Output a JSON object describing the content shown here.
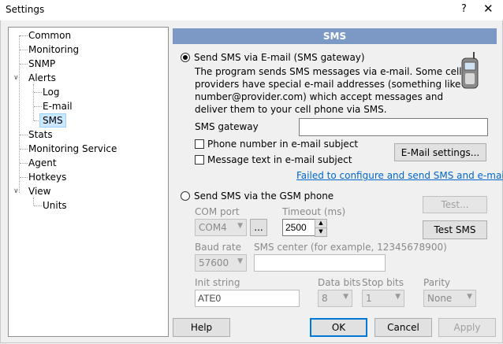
{
  "window": {
    "title": "Settings",
    "help_glyph": "?",
    "close_glyph": "✕"
  },
  "tree": {
    "items": [
      {
        "label": "Common"
      },
      {
        "label": "Monitoring"
      },
      {
        "label": "SNMP"
      },
      {
        "label": "Alerts"
      },
      {
        "label": "Log"
      },
      {
        "label": "E-mail"
      },
      {
        "label": "SMS"
      },
      {
        "label": "Stats"
      },
      {
        "label": "Monitoring Service"
      },
      {
        "label": "Agent"
      },
      {
        "label": "Hotkeys"
      },
      {
        "label": "View"
      },
      {
        "label": "Units"
      }
    ],
    "selected": "SMS"
  },
  "panel": {
    "header": "SMS",
    "email_option": {
      "label": "Send SMS via E-mail (SMS gateway)",
      "selected": true,
      "description": "The program sends SMS messages via e-mail. Some cell providers have special e-mail addresses (something like number@provider.com) which accept messages and deliver them to your cell phone via SMS.",
      "gateway_label": "SMS gateway",
      "gateway_value": "",
      "phone_in_subject": "Phone number in e-mail subject",
      "message_in_subject": "Message text in e-mail subject",
      "email_settings_button": "E-Mail settings...",
      "fail_link": "Failed to configure and send SMS and e-mail?"
    },
    "gsm_option": {
      "label": "Send SMS via the GSM phone",
      "selected": false,
      "com_port_label": "COM port",
      "com_port_value": "COM4",
      "browse_button": "...",
      "timeout_label": "Timeout (ms)",
      "timeout_value": "2500",
      "test_button": "Test...",
      "test_sms_button": "Test SMS",
      "baud_rate_label": "Baud rate",
      "baud_rate_value": "57600",
      "sms_center_label": "SMS center (for example, 12345678900)",
      "sms_center_value": "",
      "init_string_label": "Init string",
      "init_string_value": "ATE0",
      "data_bits_label": "Data bits",
      "data_bits_value": "8",
      "stop_bits_label": "Stop bits",
      "stop_bits_value": "1",
      "parity_label": "Parity",
      "parity_value": "None"
    }
  },
  "footer": {
    "help": "Help",
    "ok": "OK",
    "cancel": "Cancel",
    "apply": "Apply"
  }
}
